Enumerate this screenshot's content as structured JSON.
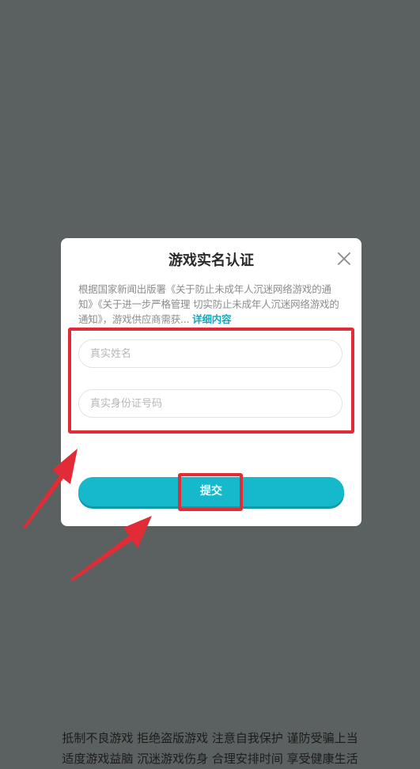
{
  "dialog": {
    "title": "游戏实名认证",
    "close_icon": "close-icon",
    "notice_text": "根据国家新闻出版署《关于防止未成年人沉迷网络游戏的通知》《关于进一步严格管理 切实防止未成年人沉迷网络游戏的通知》，游戏供应商需获...",
    "notice_link": "详细内容",
    "name_placeholder": "真实姓名",
    "id_placeholder": "真实身份证号码",
    "submit_label": "提交"
  },
  "footer": {
    "line1": "抵制不良游戏 拒绝盗版游戏 注意自我保护 谨防受骗上当",
    "line2": "适度游戏益脑 沉迷游戏伤身 合理安排时间 享受健康生活"
  },
  "colors": {
    "backdrop": "#5b6160",
    "accent": "#16b9cc",
    "link": "#13a9bf",
    "highlight": "#e12b36"
  }
}
